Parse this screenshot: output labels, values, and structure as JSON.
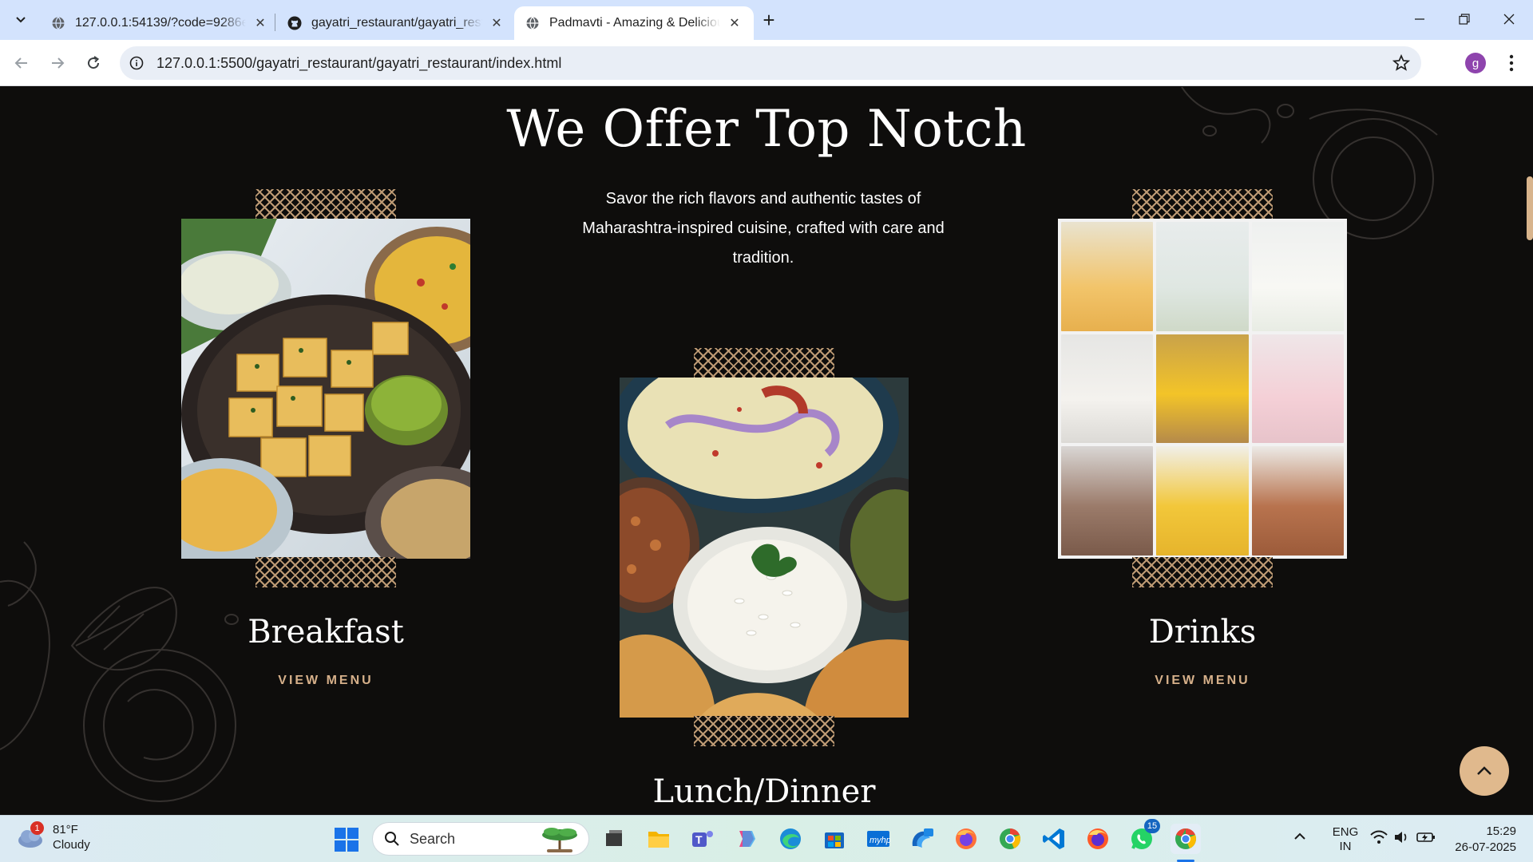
{
  "browser": {
    "tabs": [
      {
        "title": "127.0.0.1:54139/?code=9286ee...",
        "icon": "globe-icon"
      },
      {
        "title": "gayatri_restaurant/gayatri_resta...",
        "icon": "github-icon"
      },
      {
        "title": "Padmavti - Amazing & Delicious",
        "icon": "globe-icon",
        "active": true
      }
    ],
    "url": "127.0.0.1:5500/gayatri_restaurant/gayatri_restaurant/index.html",
    "profile_initial": "g"
  },
  "page": {
    "heading": "We Offer Top Notch",
    "intro": "Savor the rich flavors and authentic tastes of Maharashtra-inspired cuisine, crafted with care and tradition.",
    "cards": [
      {
        "title": "Breakfast",
        "cta": "VIEW MENU"
      },
      {
        "title": "Lunch/Dinner"
      },
      {
        "title": "Drinks",
        "cta": "VIEW MENU"
      }
    ],
    "colors": {
      "accent": "#d6b08a",
      "background": "#0e0d0c",
      "scroll_button": "#e0b98d"
    }
  },
  "taskbar": {
    "weather": {
      "temp": "81°F",
      "condition": "Cloudy",
      "badge": "1"
    },
    "search_placeholder": "Search",
    "whatsapp_badge": "15",
    "language": {
      "line1": "ENG",
      "line2": "IN"
    },
    "time": "15:29",
    "date": "26-07-2025"
  }
}
